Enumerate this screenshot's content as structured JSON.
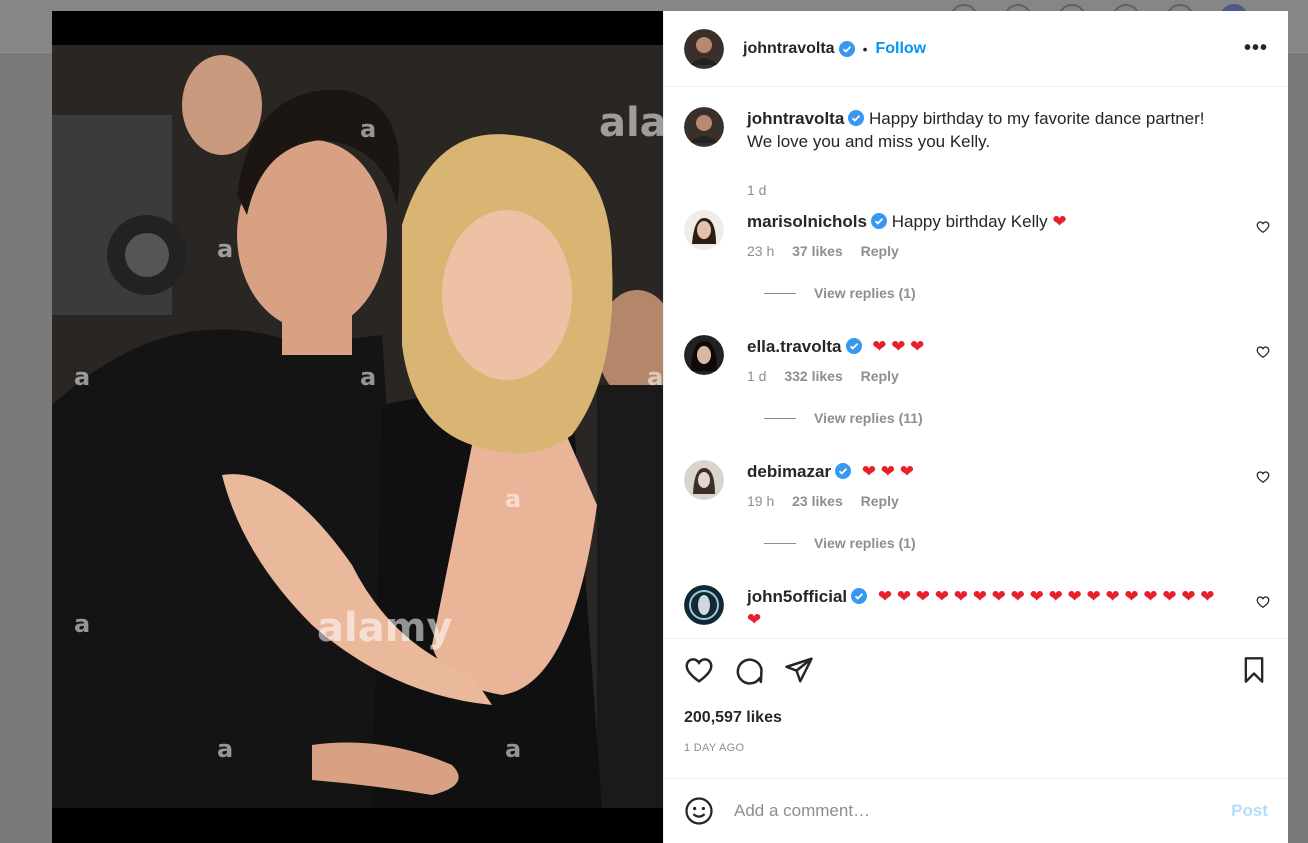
{
  "post": {
    "author": "johntravolta",
    "follow_label": "Follow",
    "more_label": "•••",
    "likes": "200,597 likes",
    "time_ago": "1 DAY AGO"
  },
  "photo": {
    "watermarks": [
      "alar",
      "a",
      "a",
      "a",
      "a",
      "a",
      "a",
      "alamy",
      "a",
      "a",
      "a"
    ]
  },
  "caption": {
    "username": "johntravolta",
    "text": "Happy birthday to my favorite dance partner! We love you and miss you Kelly.",
    "time": "1 d"
  },
  "comments": [
    {
      "username": "marisolnichols",
      "text": "Happy birthday Kelly",
      "hearts": "❤",
      "time": "23 h",
      "likes": "37 likes",
      "reply": "Reply",
      "view_replies": "View replies (1)"
    },
    {
      "username": "ella.travolta",
      "text": "",
      "hearts": "❤ ❤ ❤",
      "time": "1 d",
      "likes": "332 likes",
      "reply": "Reply",
      "view_replies": "View replies (11)"
    },
    {
      "username": "debimazar",
      "text": "",
      "hearts": "❤ ❤ ❤",
      "time": "19 h",
      "likes": "23 likes",
      "reply": "Reply",
      "view_replies": "View replies (1)"
    },
    {
      "username": "john5official",
      "text": "",
      "hearts": "❤ ❤ ❤ ❤ ❤ ❤ ❤ ❤ ❤ ❤ ❤ ❤ ❤ ❤ ❤ ❤ ❤ ❤ ❤"
    }
  ],
  "add_comment": {
    "placeholder": "Add a comment…",
    "post_label": "Post"
  },
  "colors": {
    "link_blue": "#0095f6",
    "verified_blue": "#3897f0",
    "heart_red": "#e8202a",
    "muted": "#8e8e8e"
  }
}
